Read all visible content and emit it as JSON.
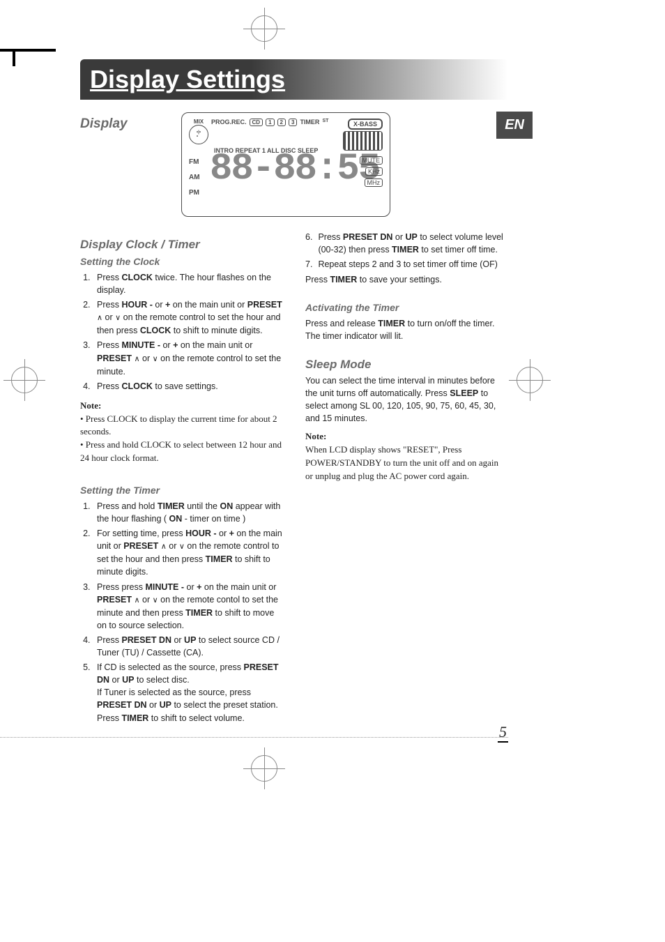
{
  "banner_title": "Display Settings",
  "lang_badge": "EN",
  "page_number": "5",
  "display": {
    "heading": "Display",
    "lcd": {
      "top_labels": [
        "PROG.REC.",
        "CD",
        "1",
        "2",
        "3",
        "TIMER"
      ],
      "st_label": "ST",
      "xbass": "X-BASS",
      "second_row": "INTRO REPEAT 1 ALL DISC SLEEP",
      "bands": [
        "FM",
        "AM",
        "PM"
      ],
      "digits": "88-88:55",
      "units": [
        "MUTE",
        "KHz",
        "MHz"
      ]
    }
  },
  "clock_timer": {
    "heading": "Display Clock / Timer",
    "setting_clock": {
      "heading": "Setting the Clock",
      "steps": [
        {
          "pre": "Press ",
          "b1": "CLOCK",
          "post": " twice. The hour flashes on the display."
        },
        {
          "pre": "Press ",
          "b1": "HOUR -",
          "mid1": " or ",
          "b2": "+",
          "mid2": " on the main unit or ",
          "b3": "PRESET",
          "wedge1": "up",
          "mid3": " or ",
          "wedge2": "dn",
          "mid4": " on the remote control to set the hour and then press ",
          "b4": "CLOCK",
          "post": " to shift to minute digits."
        },
        {
          "pre": "Press ",
          "b1": "MINUTE -",
          "mid1": " or ",
          "b2": "+",
          "mid2": " on the main unit or ",
          "b3": "PRESET",
          "wedge1": "up",
          "mid3": " or ",
          "wedge2": "dn",
          "post": " on the remote control to set the minute."
        },
        {
          "pre": "Press ",
          "b1": "CLOCK",
          "post": " to save settings."
        }
      ],
      "note_title": "Note:",
      "note_body1": "• Press CLOCK to display the current time for about 2 seconds.",
      "note_body2": "• Press and hold CLOCK to select between 12 hour and 24 hour clock format."
    },
    "setting_timer": {
      "heading": "Setting the Timer",
      "steps": [
        {
          "pre": "Press and hold ",
          "b1": "TIMER",
          "mid1": " until the ",
          "b2": "ON",
          "mid2": " appear with the hour flashing ( ",
          "b3": "ON",
          "post": " - timer on time )"
        },
        {
          "pre": "For setting time, press ",
          "b1": "HOUR -",
          "mid1": " or ",
          "b2": "+",
          "mid2": " on the main unit or ",
          "b3": "PRESET",
          "wedge1": "up",
          "mid3": " or ",
          "wedge2": "dn",
          "mid4": " on the remote control to set the hour and then press ",
          "b4": "TIMER",
          "post": " to shift to minute digits."
        },
        {
          "pre": "Press press ",
          "b1": "MINUTE -",
          "mid1": " or ",
          "b2": "+",
          "mid2": " on the main unit or ",
          "b3": "PRESET",
          "wedge1": "up",
          "mid3": " or ",
          "wedge2": "dn",
          "mid4": " on the remote contol to set the minute and then press ",
          "b4": "TIMER",
          "post": " to shift to move on to source selection."
        },
        {
          "pre": "Press ",
          "b1": "PRESET DN",
          "mid1": " or ",
          "b2": "UP",
          "post": " to select source CD / Tuner (TU) / Cassette (CA)."
        },
        {
          "pre": "If CD is selected as the source, press ",
          "b1": "PRESET DN",
          "mid1": " or ",
          "b2": "UP",
          "mid2": " to select disc.\nIf Tuner is selected as the source, press ",
          "b3": "PRESET DN",
          "mid3": " or ",
          "b4": "UP",
          "mid4": " to select the preset station. Press ",
          "b5": "TIMER",
          "post": " to shift to select volume."
        }
      ]
    }
  },
  "right_col": {
    "cont_steps": [
      {
        "num": "6.",
        "pre": "Press ",
        "b1": "PRESET DN",
        "mid1": " or ",
        "b2": "UP",
        "mid2": " to select volume level (00-32) then press ",
        "b3": "TIMER",
        "post": " to set timer off time."
      },
      {
        "num": "7.",
        "pre": "Repeat steps 2 and 3 to set timer off time (OF)"
      }
    ],
    "cont_tail_pre": "Press ",
    "cont_tail_b": "TIMER",
    "cont_tail_post": " to save your settings.",
    "activating": {
      "heading": "Activating the Timer",
      "body_pre": "Press and release ",
      "body_b": "TIMER",
      "body_post": " to turn on/off the timer. The timer indicator will lit."
    },
    "sleep": {
      "heading": "Sleep Mode",
      "body_pre": "You can select the time interval in minutes before the unit turns off automatically. Press ",
      "body_b": "SLEEP",
      "body_post": " to select among SL 00, 120, 105, 90, 75, 60, 45, 30, and 15 minutes.",
      "note_title": "Note:",
      "note_body": "When LCD display shows \"RESET\", Press POWER/STANDBY to turn the unit off and on again or unplug and plug the AC power cord again."
    }
  }
}
